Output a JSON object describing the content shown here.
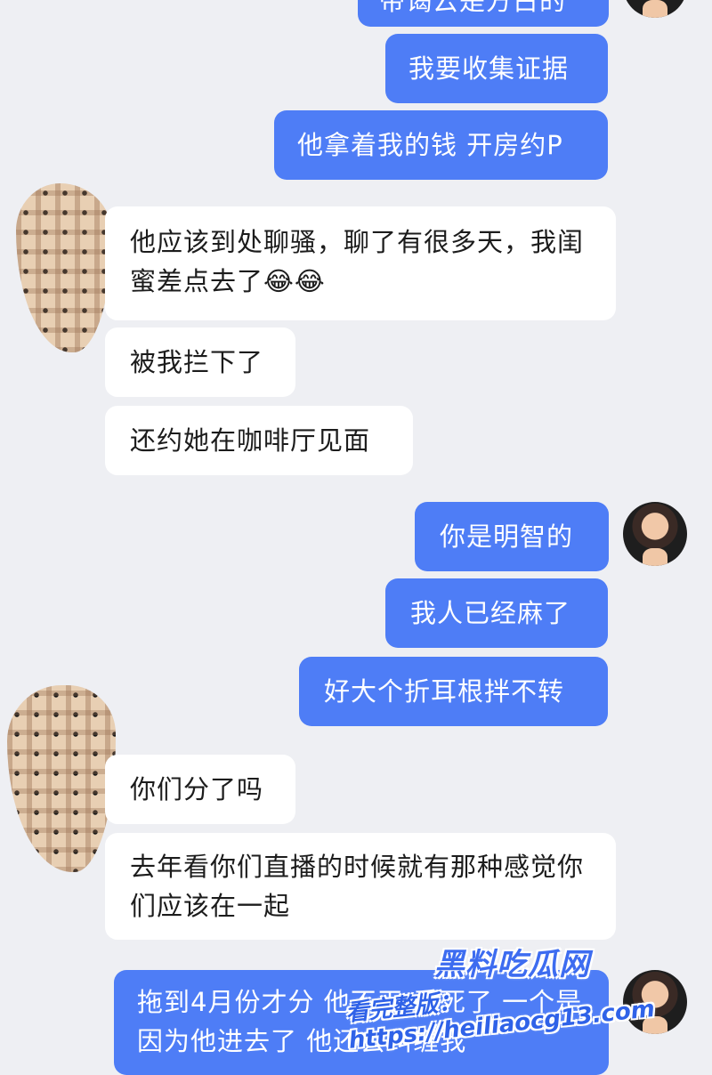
{
  "messages": [
    {
      "dir": "out",
      "text": "带谒云是方占的"
    },
    {
      "dir": "out",
      "text": "我要收集证据"
    },
    {
      "dir": "out",
      "text": "他拿着我的钱 开房约P"
    },
    {
      "dir": "in",
      "text": "他应该到处聊骚，聊了有很多天，我闺蜜差点去了😂😂"
    },
    {
      "dir": "in",
      "text": "被我拦下了"
    },
    {
      "dir": "in",
      "text": "还约她在咖啡厅见面"
    },
    {
      "dir": "out",
      "text": "你是明智的"
    },
    {
      "dir": "out",
      "text": "我人已经麻了"
    },
    {
      "dir": "out",
      "text": "好大个折耳根拌不转"
    },
    {
      "dir": "in",
      "text": "你们分了吗"
    },
    {
      "dir": "in",
      "text": "去年看你们直播的时候就有那种感觉你们应该在一起"
    },
    {
      "dir": "out",
      "text": "拖到4月份才分 他不干 丢死了 一个是因为他进去了 他还会纠缠我"
    }
  ],
  "watermark": {
    "brand": "黑料吃瓜网",
    "url_line": "看完整版：https://heiliaocg13.com"
  },
  "colors": {
    "outgoing": "#4e7df6",
    "incoming": "#ffffff",
    "background": "#eeeff3"
  }
}
